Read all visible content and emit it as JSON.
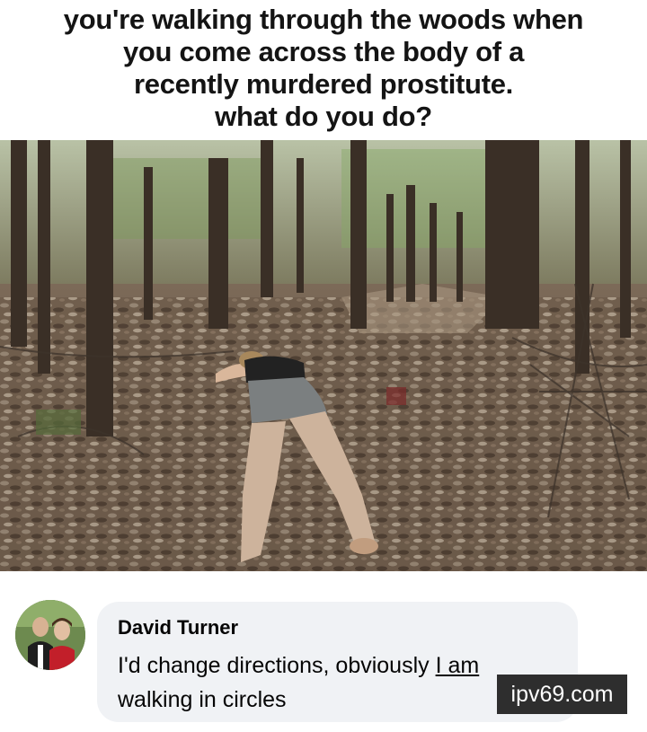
{
  "caption": {
    "lines": [
      "you're walking through the woods when",
      "you come across the body of a",
      "recently murdered prostitute.",
      "what do you do?"
    ]
  },
  "photo": {
    "subject": "forest-floor-photo"
  },
  "comment": {
    "author": "David Turner",
    "text_line1_start": "I'd change directions, obviously ",
    "text_line1_underlined": "I am",
    "text_line2": "walking in circles"
  },
  "watermark": {
    "text": "ipv69.com"
  },
  "colors": {
    "bubble_bg": "#f0f2f5",
    "text": "#050505",
    "watermark_bg": "#2e2e2e"
  }
}
